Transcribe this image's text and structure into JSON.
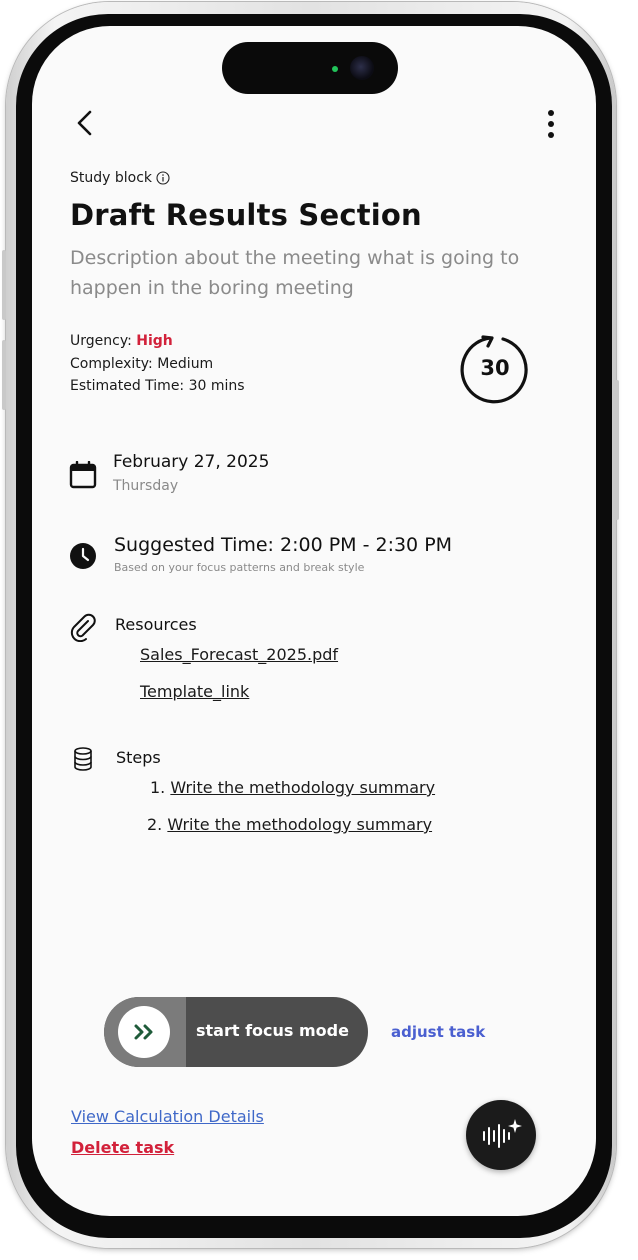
{
  "header": {
    "back_icon": "chevron-left-icon",
    "menu_icon": "more-vertical-icon"
  },
  "task": {
    "block_label": "Study block",
    "title": "Draft Results Section",
    "description": "Description about the meeting what is going to happen in the boring meeting",
    "urgency_label": "Urgency: ",
    "urgency_value": "High",
    "complexity": "Complexity: Medium",
    "estimated_time": "Estimated Time: 30 mins",
    "timer_value": "30"
  },
  "date": {
    "main": "February 27, 2025",
    "weekday": "Thursday"
  },
  "suggested": {
    "main": "Suggested Time: 2:00 PM - 2:30 PM",
    "sub": "Based on your focus patterns and break style"
  },
  "resources": {
    "heading": "Resources",
    "items": [
      "Sales_Forecast_2025.pdf",
      "Template_link"
    ]
  },
  "steps": {
    "heading": "Steps",
    "items": [
      {
        "num": "1.",
        "text": "Write the methodology summary"
      },
      {
        "num": "2.",
        "text": "Write the methodology summary"
      }
    ]
  },
  "actions": {
    "focus_label": "start focus mode",
    "adjust_label": "adjust task",
    "calc_link": "View Calculation Details",
    "delete_link": "Delete task"
  },
  "colors": {
    "urgency_high": "#d2213a",
    "link_blue": "#3f68c8",
    "adjust_blue": "#4a5fd0",
    "focus_arrow": "#1f5b3a"
  }
}
